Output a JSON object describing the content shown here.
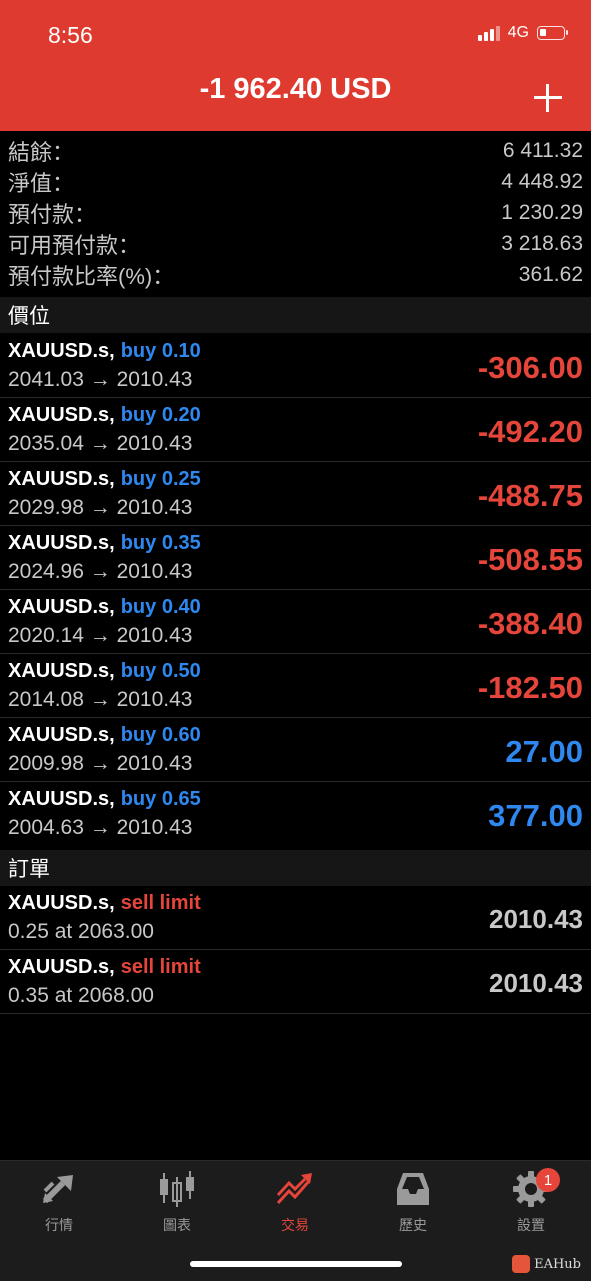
{
  "status_bar": {
    "time": "8:56",
    "network": "4G"
  },
  "header": {
    "title": "-1 962.40 USD",
    "add_label": "+"
  },
  "summary": [
    {
      "label": "結餘：",
      "value": "6 411.32"
    },
    {
      "label": "淨值：",
      "value": "4 448.92"
    },
    {
      "label": "預付款：",
      "value": "1 230.29"
    },
    {
      "label": "可用預付款：",
      "value": "3 218.63"
    },
    {
      "label": "預付款比率(%)：",
      "value": "361.62"
    }
  ],
  "positions": {
    "title": "價位",
    "items": [
      {
        "symbol": "XAUUSD.s,",
        "side": "buy 0.10",
        "prices": "2041.03 → 2010.43",
        "pl": "-306.00"
      },
      {
        "symbol": "XAUUSD.s,",
        "side": "buy 0.20",
        "prices": "2035.04 → 2010.43",
        "pl": "-492.20"
      },
      {
        "symbol": "XAUUSD.s,",
        "side": "buy 0.25",
        "prices": "2029.98 → 2010.43",
        "pl": "-488.75"
      },
      {
        "symbol": "XAUUSD.s,",
        "side": "buy 0.35",
        "prices": "2024.96 → 2010.43",
        "pl": "-508.55"
      },
      {
        "symbol": "XAUUSD.s,",
        "side": "buy 0.40",
        "prices": "2020.14 → 2010.43",
        "pl": "-388.40"
      },
      {
        "symbol": "XAUUSD.s,",
        "side": "buy 0.50",
        "prices": "2014.08 → 2010.43",
        "pl": "-182.50"
      },
      {
        "symbol": "XAUUSD.s,",
        "side": "buy 0.60",
        "prices": "2009.98 → 2010.43",
        "pl": "27.00"
      },
      {
        "symbol": "XAUUSD.s,",
        "side": "buy 0.65",
        "prices": "2004.63 → 2010.43",
        "pl": "377.00"
      }
    ]
  },
  "orders": {
    "title": "訂單",
    "items": [
      {
        "symbol": "XAUUSD.s,",
        "side": "sell limit",
        "detail": "0.25 at 2063.00",
        "price": "2010.43"
      },
      {
        "symbol": "XAUUSD.s,",
        "side": "sell limit",
        "detail": "0.35 at 2068.00",
        "price": "2010.43"
      }
    ]
  },
  "tabs": [
    {
      "label": "行情",
      "icon": "quotes-arrows-icon"
    },
    {
      "label": "圖表",
      "icon": "candlestick-chart-icon"
    },
    {
      "label": "交易",
      "icon": "trade-trend-icon",
      "active": true
    },
    {
      "label": "歷史",
      "icon": "inbox-history-icon"
    },
    {
      "label": "設置",
      "icon": "gear-icon",
      "badge": "1"
    }
  ],
  "watermark": "EAHub",
  "colors": {
    "header_red": "#df3a2f",
    "loss_red": "#e5453a",
    "profit_blue": "#2f88f0",
    "background": "#000000"
  }
}
